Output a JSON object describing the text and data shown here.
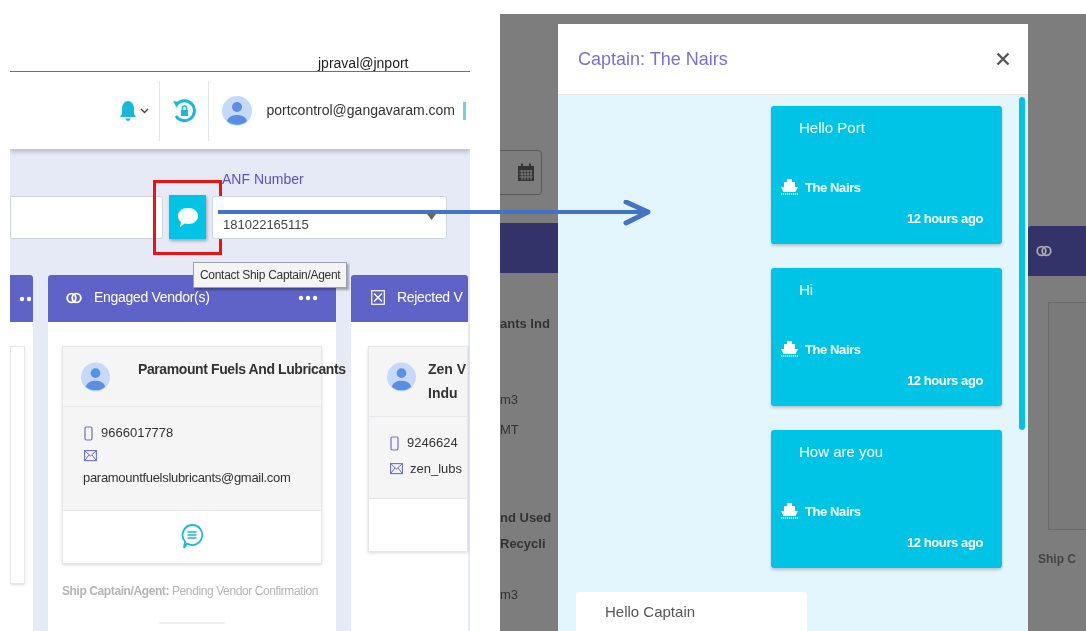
{
  "left_screen": {
    "user_label": "jpraval@jnport",
    "header": {
      "email": "portcontrol@gangavaram.com"
    },
    "anf": {
      "label": "ANF Number",
      "value": "181022165115"
    },
    "contact_button": {
      "tooltip": "Contact Ship Captain/Agent",
      "highlighted": true
    },
    "columns": [
      {
        "kind": "engaged",
        "title": "Engaged Vendor(s)",
        "vendor": {
          "name": "Paramount Fuels And Lubricants",
          "phone": "9666017778",
          "email": "paramountfuelslubricants@gmail.com"
        },
        "status_label": "Ship Captain/Agent:",
        "status": "Pending Vendor Confirmation"
      },
      {
        "kind": "rejected",
        "title": "Rejected V",
        "vendor": {
          "name": "Zen V Indu",
          "phone": "9246624",
          "email": "zen_lubs"
        }
      }
    ]
  },
  "right_screen": {
    "background_left": [
      "ants Ind",
      "m3",
      "MT",
      "nd Used",
      "Recycli",
      "m3"
    ],
    "background_right": [
      "Ship C"
    ],
    "dialog": {
      "title": "Captain: The Nairs",
      "messages": [
        {
          "kind": "received",
          "text": "Hello Port",
          "sender": "The Nairs",
          "time": "12 hours ago"
        },
        {
          "kind": "received",
          "text": "Hi",
          "sender": "The Nairs",
          "time": "12 hours ago"
        },
        {
          "kind": "received",
          "text": "How are you",
          "sender": "The Nairs",
          "time": "12 hours ago"
        },
        {
          "kind": "sent",
          "text": "Hello Captain"
        }
      ]
    }
  }
}
